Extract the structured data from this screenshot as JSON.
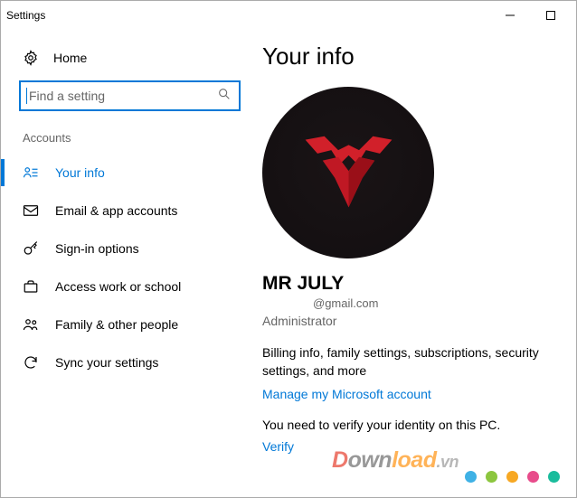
{
  "window": {
    "title": "Settings"
  },
  "sidebar": {
    "home": "Home",
    "search_placeholder": "Find a setting",
    "section": "Accounts",
    "items": [
      {
        "label": "Your info"
      },
      {
        "label": "Email & app accounts"
      },
      {
        "label": "Sign-in options"
      },
      {
        "label": "Access work or school"
      },
      {
        "label": "Family & other people"
      },
      {
        "label": "Sync your settings"
      }
    ]
  },
  "main": {
    "title": "Your info",
    "user_name": "MR JULY",
    "user_email": "@gmail.com",
    "user_role": "Administrator",
    "info_text": "Billing info, family settings, subscriptions, security settings, and more",
    "manage_link": "Manage my Microsoft account",
    "verify_text": "You need to verify your identity on this PC.",
    "verify_link": "Verify"
  },
  "watermark": {
    "text": "Download.vn"
  },
  "dots": [
    "#3fb1e5",
    "#8cc63f",
    "#f7a823",
    "#e84c8b",
    "#1abc9c"
  ]
}
